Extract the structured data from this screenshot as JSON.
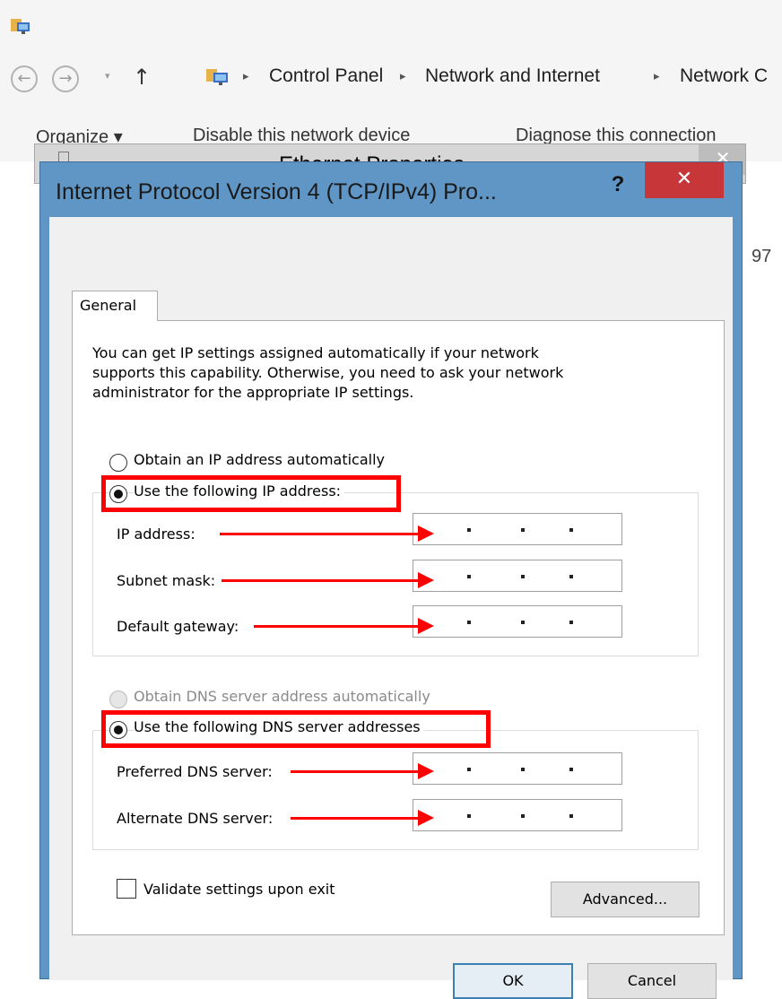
{
  "explorer": {
    "nav": {
      "back_glyph": "←",
      "forward_glyph": "→",
      "dropdown_glyph": "▾",
      "up_glyph": "↑",
      "separator": "▸",
      "breadcrumb": [
        "Control Panel",
        "Network and Internet",
        "Network C"
      ]
    },
    "toolbar": {
      "organize": "Organize ▾",
      "disable": "Disable this network device",
      "diagnose": "Diagnose this connection"
    },
    "side_text": "97"
  },
  "ethernet_dialog": {
    "title": "Ethernet Properties",
    "close_glyph": "✕"
  },
  "dialog": {
    "title": "Internet Protocol Version 4 (TCP/IPv4) Pro...",
    "help_glyph": "?",
    "close_glyph": "✕",
    "tab": "General",
    "description": [
      "You can get IP settings assigned automatically if your network",
      "supports this capability. Otherwise, you need to ask your network",
      "administrator for the appropriate IP settings."
    ],
    "ip_options": {
      "auto": "Obtain an IP address automatically",
      "manual": "Use the following IP address:",
      "selected": "manual"
    },
    "ip_fields": {
      "ip_address": "IP address:",
      "subnet_mask": "Subnet mask:",
      "default_gateway": "Default gateway:"
    },
    "dns_options": {
      "auto": "Obtain DNS server address automatically",
      "manual": "Use the following DNS server addresses",
      "selected": "manual",
      "auto_disabled": true
    },
    "dns_fields": {
      "preferred": "Preferred DNS server:",
      "alternate": "Alternate DNS server:"
    },
    "validate_label": "Validate settings upon exit",
    "validate_checked": false,
    "advanced_button": "Advanced...",
    "ok_button": "OK",
    "cancel_button": "Cancel"
  },
  "colors": {
    "dialog_frame": "#5f96c5",
    "close_button": "#c7373a",
    "annotation": "#ff0000"
  }
}
